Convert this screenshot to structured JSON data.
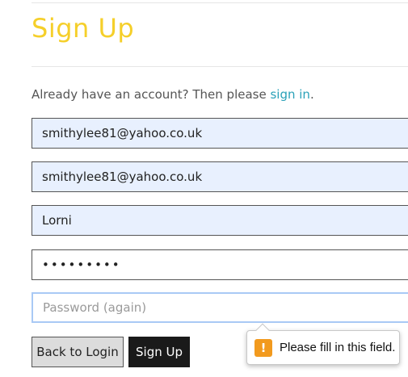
{
  "page": {
    "title": "Sign Up",
    "signin_prompt": "Already have an account? Then please ",
    "signin_link": "sign in",
    "signin_period": "."
  },
  "form": {
    "email": "smithylee81@yahoo.co.uk",
    "email_confirm": "smithylee81@yahoo.co.uk",
    "username": "Lorni",
    "password_masked": "•••••••••",
    "password_again_placeholder": "Password (again)"
  },
  "buttons": {
    "back_label": "Back to Login",
    "signup_label": "Sign Up"
  },
  "validation": {
    "message": "Please fill in this field.",
    "icon": "!"
  },
  "colors": {
    "title": "#f5cf2a",
    "link": "#2aa1b8",
    "autofill": "#e8f0fe",
    "warning": "#f29a1e"
  }
}
